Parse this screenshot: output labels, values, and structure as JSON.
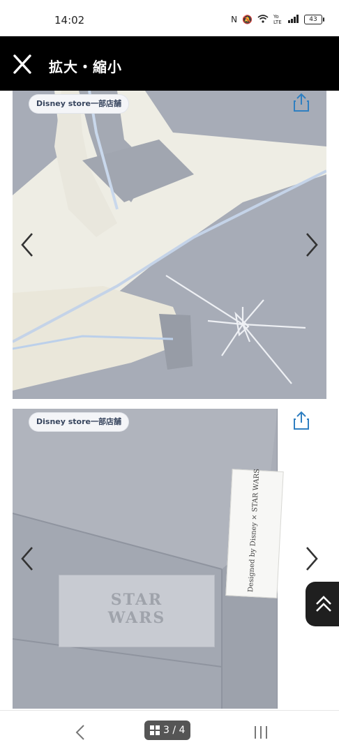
{
  "status_bar": {
    "time": "14:02",
    "network_label": "Yo LTE",
    "battery": "43"
  },
  "header": {
    "title": "拡大・縮小",
    "close_icon": "close-icon"
  },
  "images": [
    {
      "store_logo": "Disney store一部店舗",
      "description_icon": "share-icon"
    },
    {
      "store_logo": "Disney store一部店舗",
      "tag_logo_line1": "STAR",
      "tag_logo_line2": "WARS",
      "side_label": "Designed by Disney × STAR WARS"
    }
  ],
  "navigation": {
    "page_current": "3",
    "page_total": "4",
    "page_text": "3 / 4"
  },
  "colors": {
    "header_bg": "#000000",
    "fabric_blue": "#a9adb7",
    "fabric_cream": "#efeee6"
  }
}
